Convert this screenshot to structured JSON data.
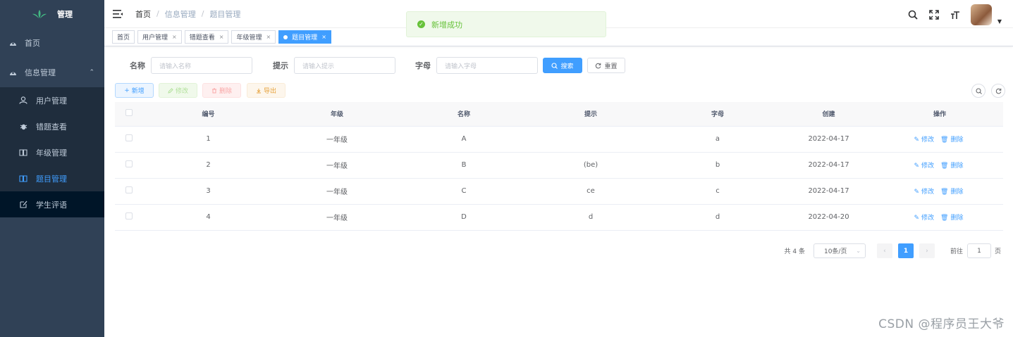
{
  "sidebar": {
    "logo_text": "管理",
    "home": {
      "label": "首页",
      "icon": "dashboard-icon"
    },
    "info_group": {
      "label": "信息管理",
      "icon": "dashboard-icon"
    },
    "items": [
      {
        "label": "用户管理",
        "icon": "people-icon"
      },
      {
        "label": "错题查看",
        "icon": "bug-icon"
      },
      {
        "label": "年级管理",
        "icon": "book-icon"
      },
      {
        "label": "题目管理",
        "icon": "book-icon"
      },
      {
        "label": "学生评语",
        "icon": "edit-icon"
      }
    ]
  },
  "breadcrumb": [
    "首页",
    "信息管理",
    "题目管理"
  ],
  "breadcrumb_sep": "/",
  "tags": [
    {
      "label": "首页"
    },
    {
      "label": "用户管理"
    },
    {
      "label": "错题查看"
    },
    {
      "label": "年级管理"
    },
    {
      "label": "题目管理"
    }
  ],
  "tag_close": "×",
  "toast": {
    "message": "新增成功",
    "color": "#67c23a"
  },
  "search": {
    "name_label": "名称",
    "name_placeholder": "请输入名称",
    "hint_label": "提示",
    "hint_placeholder": "请输入提示",
    "letter_label": "字母",
    "letter_placeholder": "请输入字母",
    "search_btn": "搜索",
    "reset_btn": "重置"
  },
  "toolbar": {
    "add": "新增",
    "edit": "修改",
    "delete": "删除",
    "export": "导出"
  },
  "table": {
    "headers": [
      "编号",
      "年级",
      "名称",
      "提示",
      "字母",
      "创建",
      "操作"
    ],
    "rows": [
      {
        "id": "1",
        "grade": "一年级",
        "name": "A",
        "hint": "",
        "letter": "a",
        "created": "2022-04-17"
      },
      {
        "id": "2",
        "grade": "一年级",
        "name": "B",
        "hint": "(be)",
        "letter": "b",
        "created": "2022-04-17"
      },
      {
        "id": "3",
        "grade": "一年级",
        "name": "C",
        "hint": "ce",
        "letter": "c",
        "created": "2022-04-17"
      },
      {
        "id": "4",
        "grade": "一年级",
        "name": "D",
        "hint": "d",
        "letter": "d",
        "created": "2022-04-20"
      }
    ],
    "row_edit": "修改",
    "row_delete": "删除"
  },
  "pagination": {
    "total": "共 4 条",
    "page_size": "10条/页",
    "current": "1",
    "goto_label": "前往",
    "goto_value": "1",
    "page_suffix": "页"
  },
  "watermark": "CSDN @程序员王大爷",
  "colors": {
    "primary": "#409eff",
    "sidebar": "#304156",
    "success": "#67c23a"
  }
}
